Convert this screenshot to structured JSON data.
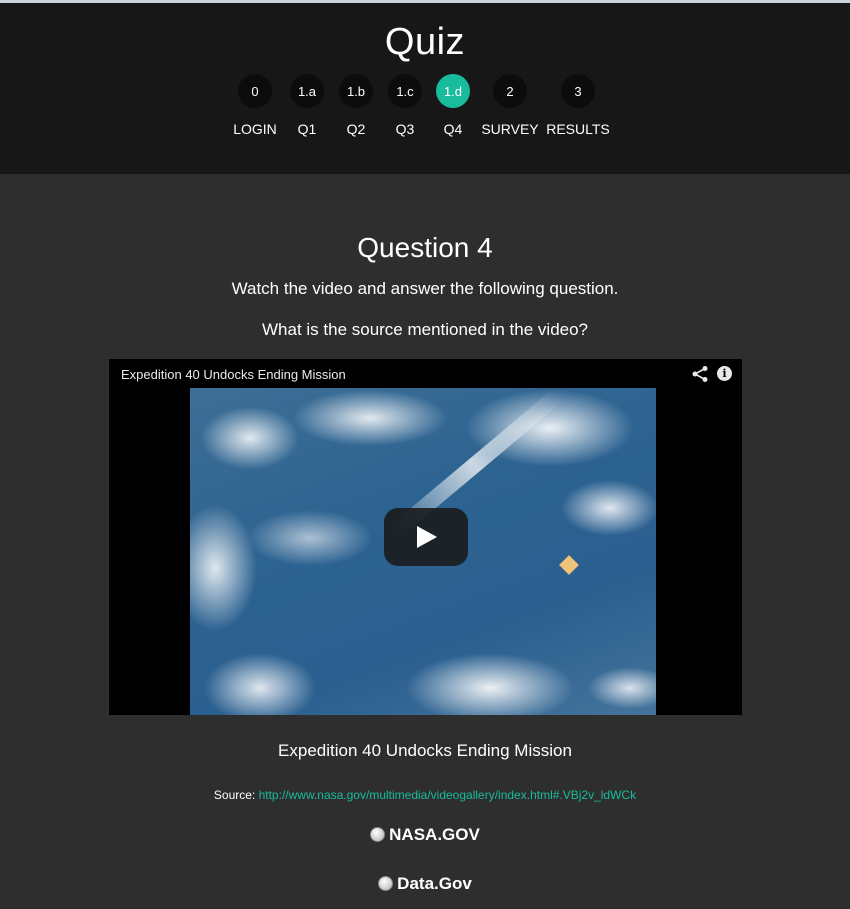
{
  "header": {
    "title": "Quiz",
    "steps": [
      {
        "badge": "0",
        "label": "LOGIN"
      },
      {
        "badge": "1.a",
        "label": "Q1"
      },
      {
        "badge": "1.b",
        "label": "Q2"
      },
      {
        "badge": "1.c",
        "label": "Q3"
      },
      {
        "badge": "1.d",
        "label": "Q4"
      },
      {
        "badge": "2",
        "label": "SURVEY"
      },
      {
        "badge": "3",
        "label": "RESULTS"
      }
    ],
    "active_step": "1.d",
    "accent_color": "#18bc9c"
  },
  "question": {
    "title": "Question 4",
    "instruction": "Watch the video and answer the following question.",
    "text": "What is the source mentioned in the video?"
  },
  "video": {
    "title": "Expedition 40 Undocks Ending Mission",
    "icons": [
      "share-icon",
      "info-icon",
      "play-icon"
    ],
    "info_glyph": "i"
  },
  "caption": "Expedition 40 Undocks Ending Mission",
  "source": {
    "label": "Source:",
    "url": "http://www.nasa.gov/multimedia/videogallery/index.html#.VBj2v_ldWCk"
  },
  "options": [
    {
      "label": "NASA.GOV",
      "checked": false
    },
    {
      "label": "Data.Gov",
      "checked": false
    }
  ]
}
